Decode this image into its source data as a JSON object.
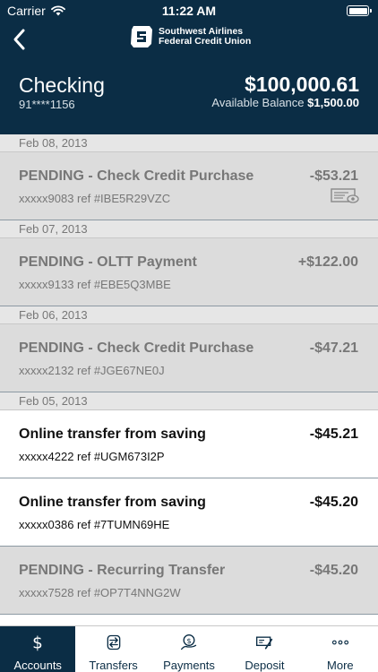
{
  "status": {
    "carrier": "Carrier",
    "time": "11:22 AM"
  },
  "header": {
    "logo_line1": "Southwest Airlines",
    "logo_line2": "Federal Credit Union",
    "account_name": "Checking",
    "account_number": "91****1156",
    "balance": "$100,000.61",
    "available_label": "Available Balance",
    "available_amount": "$1,500.00"
  },
  "transactions": [
    {
      "date": "Feb 08, 2013"
    },
    {
      "desc": "PENDING - Check Credit Purchase",
      "ref": "xxxxx9083 ref #IBE5R29VZC",
      "amount": "-$53.21",
      "icon": "check-image-icon"
    },
    {
      "date": "Feb 07, 2013"
    },
    {
      "desc": "PENDING - OLTT Payment",
      "ref": "xxxxx9133 ref #EBE5Q3MBE",
      "amount": "+$122.00"
    },
    {
      "date": "Feb 06, 2013"
    },
    {
      "desc": "PENDING - Check Credit Purchase",
      "ref": "xxxxx2132 ref #JGE67NE0J",
      "amount": "-$47.21"
    },
    {
      "date": "Feb 05, 2013"
    },
    {
      "desc": "Online transfer from saving",
      "ref": "xxxxx4222 ref #UGM673I2P",
      "amount": "-$45.21"
    },
    {
      "desc": "Online transfer from saving",
      "ref": "xxxxx0386 ref #7TUMN69HE",
      "amount": "-$45.20"
    },
    {
      "desc": "PENDING - Recurring Transfer",
      "ref": "xxxxx7528 ref #OP7T4NNG2W",
      "amount": "-$45.20"
    }
  ],
  "tabs": [
    {
      "label": "Accounts",
      "icon": "dollar-icon"
    },
    {
      "label": "Transfers",
      "icon": "transfer-icon"
    },
    {
      "label": "Payments",
      "icon": "payments-icon"
    },
    {
      "label": "Deposit",
      "icon": "deposit-check-icon"
    },
    {
      "label": "More",
      "icon": "more-dots-icon"
    }
  ],
  "colors": {
    "header_bg": "#0b2d45",
    "pending_bg": "#dcdcdc",
    "date_bg": "#e6e6e6"
  }
}
